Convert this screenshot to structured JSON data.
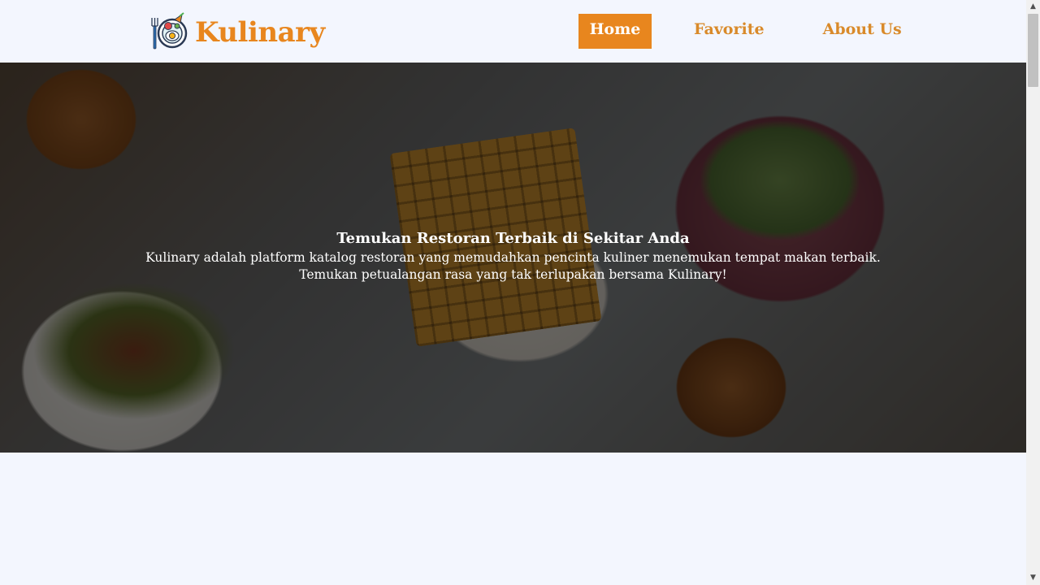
{
  "header": {
    "brand_name": "Kulinary",
    "logo_icon": "food-plate-logo-icon",
    "nav": {
      "home": "Home",
      "favorite": "Favorite",
      "about": "About Us"
    }
  },
  "hero": {
    "title": "Temukan Restoran Terbaik di Sekitar Anda",
    "desc_line1": "Kulinary adalah platform katalog restoran yang memudahkan pencinta kuliner menemukan tempat makan terbaik.",
    "desc_line2": "Temukan petualangan rasa yang tak terlupakan bersama Kulinary!"
  },
  "scrollbar": {
    "up_icon": "arrow-up-icon",
    "down_icon": "arrow-down-icon"
  },
  "colors": {
    "accent": "#e8861e",
    "background": "#f3f6fe"
  }
}
